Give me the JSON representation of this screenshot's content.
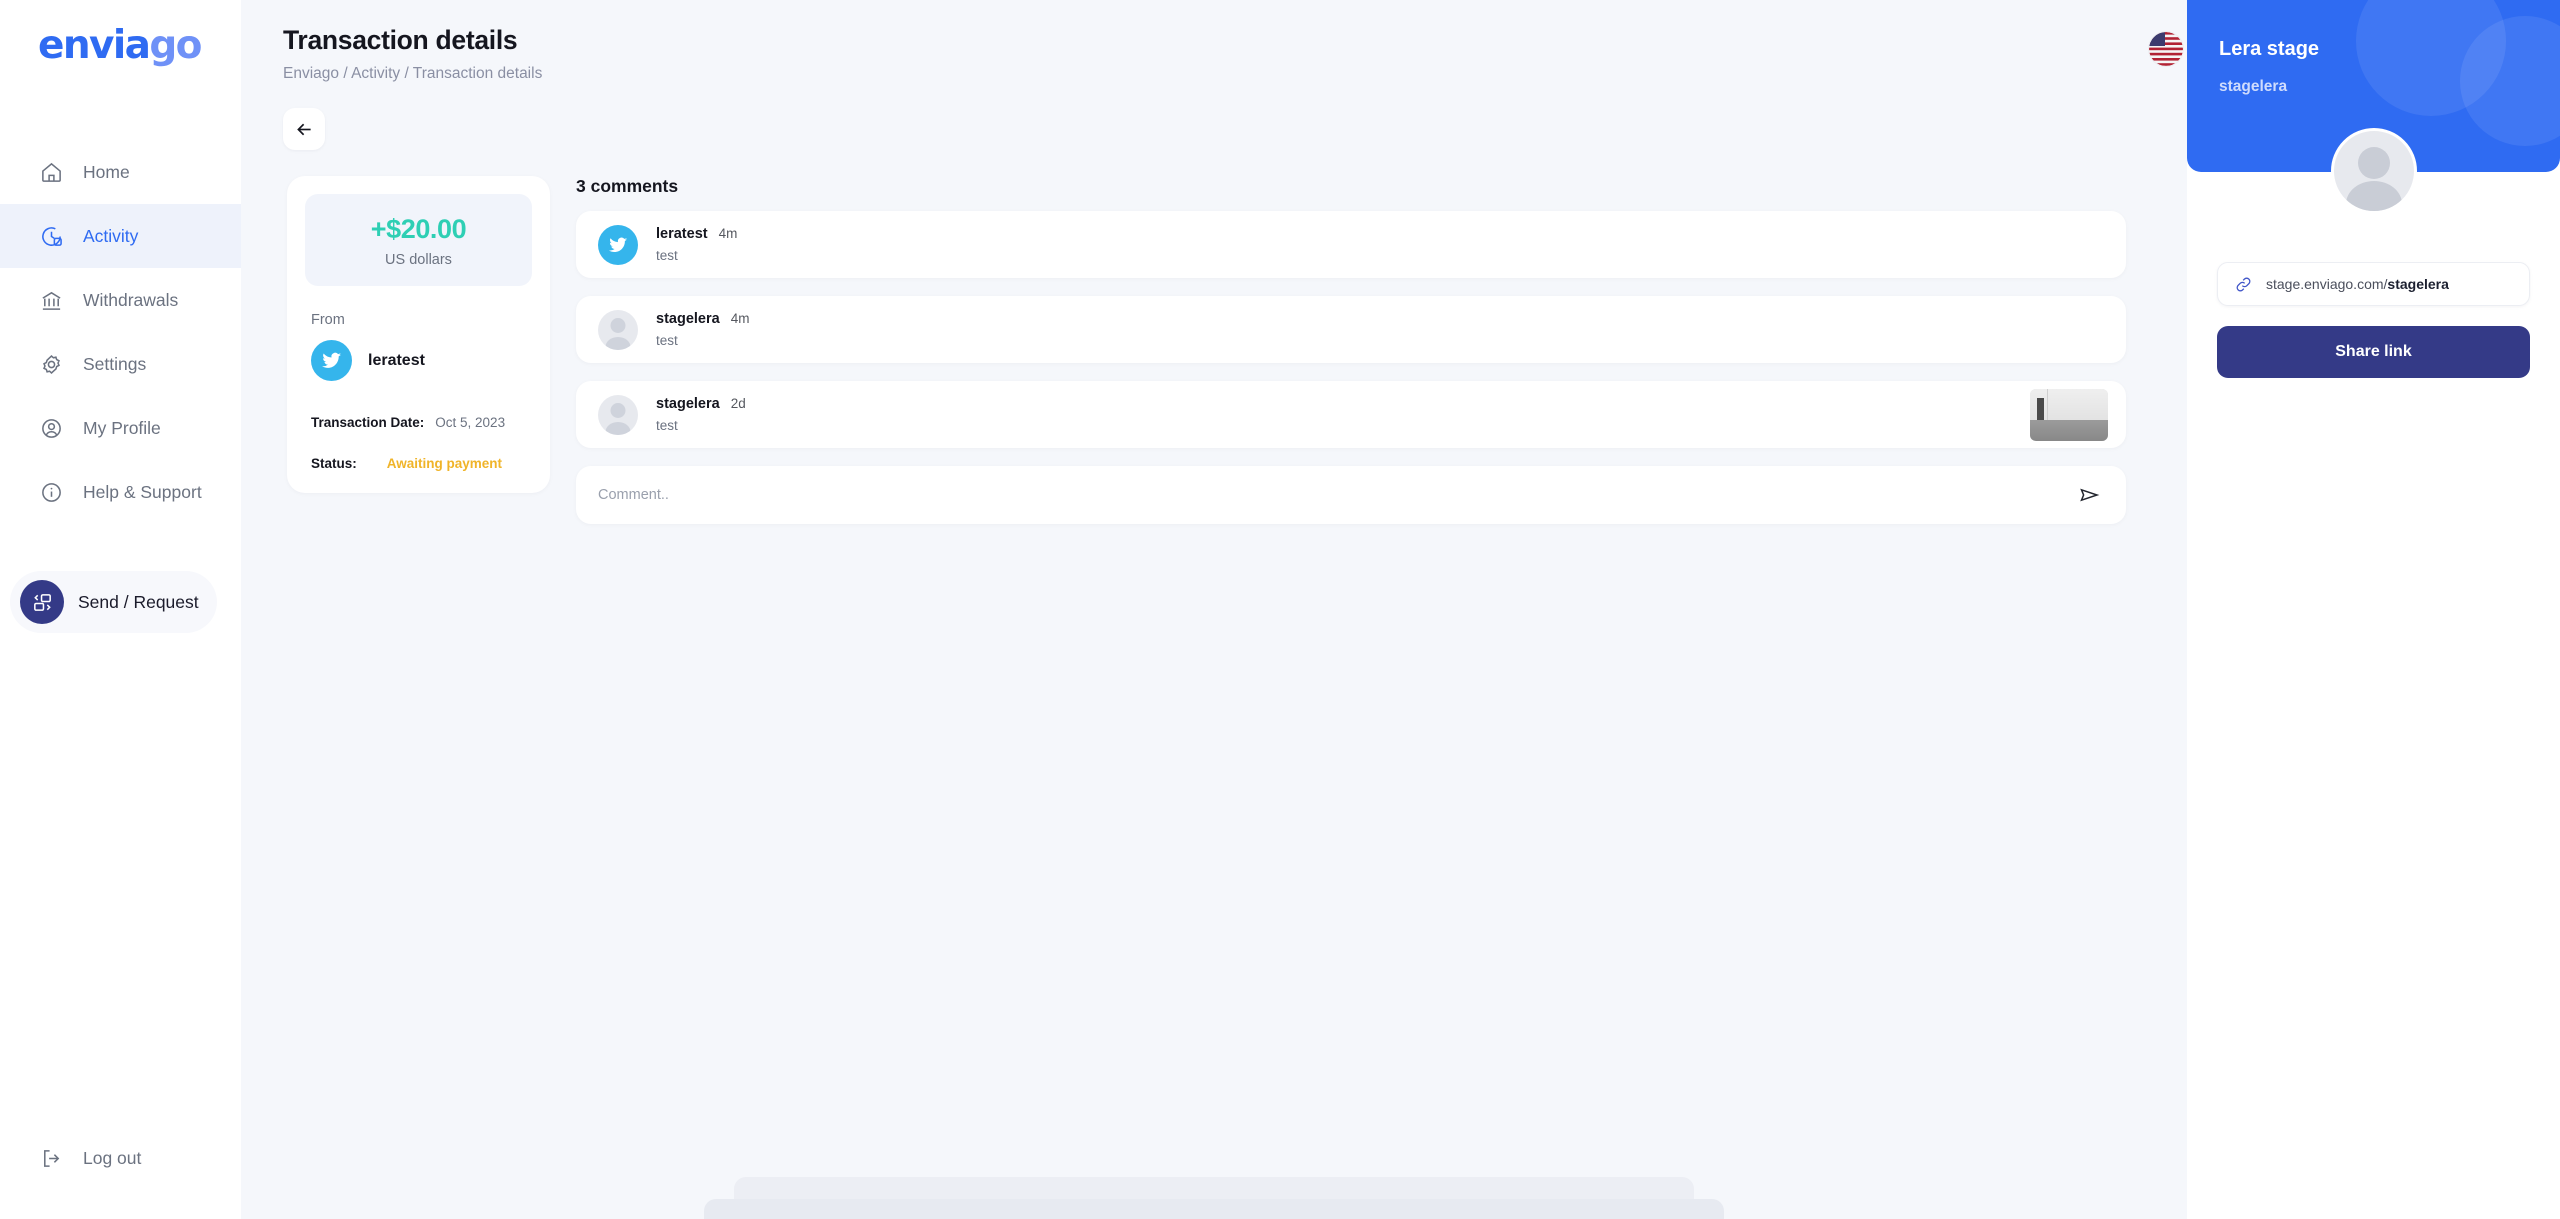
{
  "brand": {
    "name_part1": "envia",
    "name_part2": "go",
    "accent": "#2f6bf2"
  },
  "sidebar": {
    "items": [
      {
        "label": "Home",
        "icon": "home-icon",
        "active": false
      },
      {
        "label": "Activity",
        "icon": "activity-clock-icon",
        "active": true
      },
      {
        "label": "Withdrawals",
        "icon": "bank-icon",
        "active": false
      },
      {
        "label": "Settings",
        "icon": "gear-icon",
        "active": false
      },
      {
        "label": "My Profile",
        "icon": "user-circle-icon",
        "active": false
      },
      {
        "label": "Help & Support",
        "icon": "info-circle-icon",
        "active": false
      }
    ],
    "send_request_label": "Send / Request",
    "logout_label": "Log out"
  },
  "header": {
    "title": "Transaction details",
    "breadcrumb": "Enviago / Activity / Transaction details",
    "flag_icon": "us-flag-icon"
  },
  "back_button": {
    "icon": "arrow-left-icon"
  },
  "transaction": {
    "amount": "+$20.00",
    "currency": "US dollars",
    "amount_color": "#2ecfb4",
    "from_label": "From",
    "from_user": "leratest",
    "from_avatar_icon": "twitter-icon",
    "date_key": "Transaction Date:",
    "date_value": "Oct 5, 2023",
    "status_key": "Status:",
    "status_value": "Awaiting payment",
    "status_color": "#f0b429"
  },
  "comments": {
    "title": "3 comments",
    "items": [
      {
        "user": "leratest",
        "time": "4m",
        "text": "test",
        "avatar": "twitter-icon",
        "attachment": false
      },
      {
        "user": "stagelera",
        "time": "4m",
        "text": "test",
        "avatar": "placeholder-avatar-icon",
        "attachment": false
      },
      {
        "user": "stagelera",
        "time": "2d",
        "text": "test",
        "avatar": "placeholder-avatar-icon",
        "attachment": true
      }
    ],
    "input_placeholder": "Comment..",
    "input_value": "",
    "send_icon": "send-paper-plane-icon"
  },
  "profile_panel": {
    "display_name": "Lera stage",
    "handle": "stagelera",
    "avatar_icon": "placeholder-avatar-icon",
    "link_icon": "chain-link-icon",
    "link_prefix": "stage.enviago.com/",
    "link_handle": "stagelera",
    "share_button_label": "Share link",
    "card_color": "#2f6bf2",
    "button_color": "#343a87"
  }
}
